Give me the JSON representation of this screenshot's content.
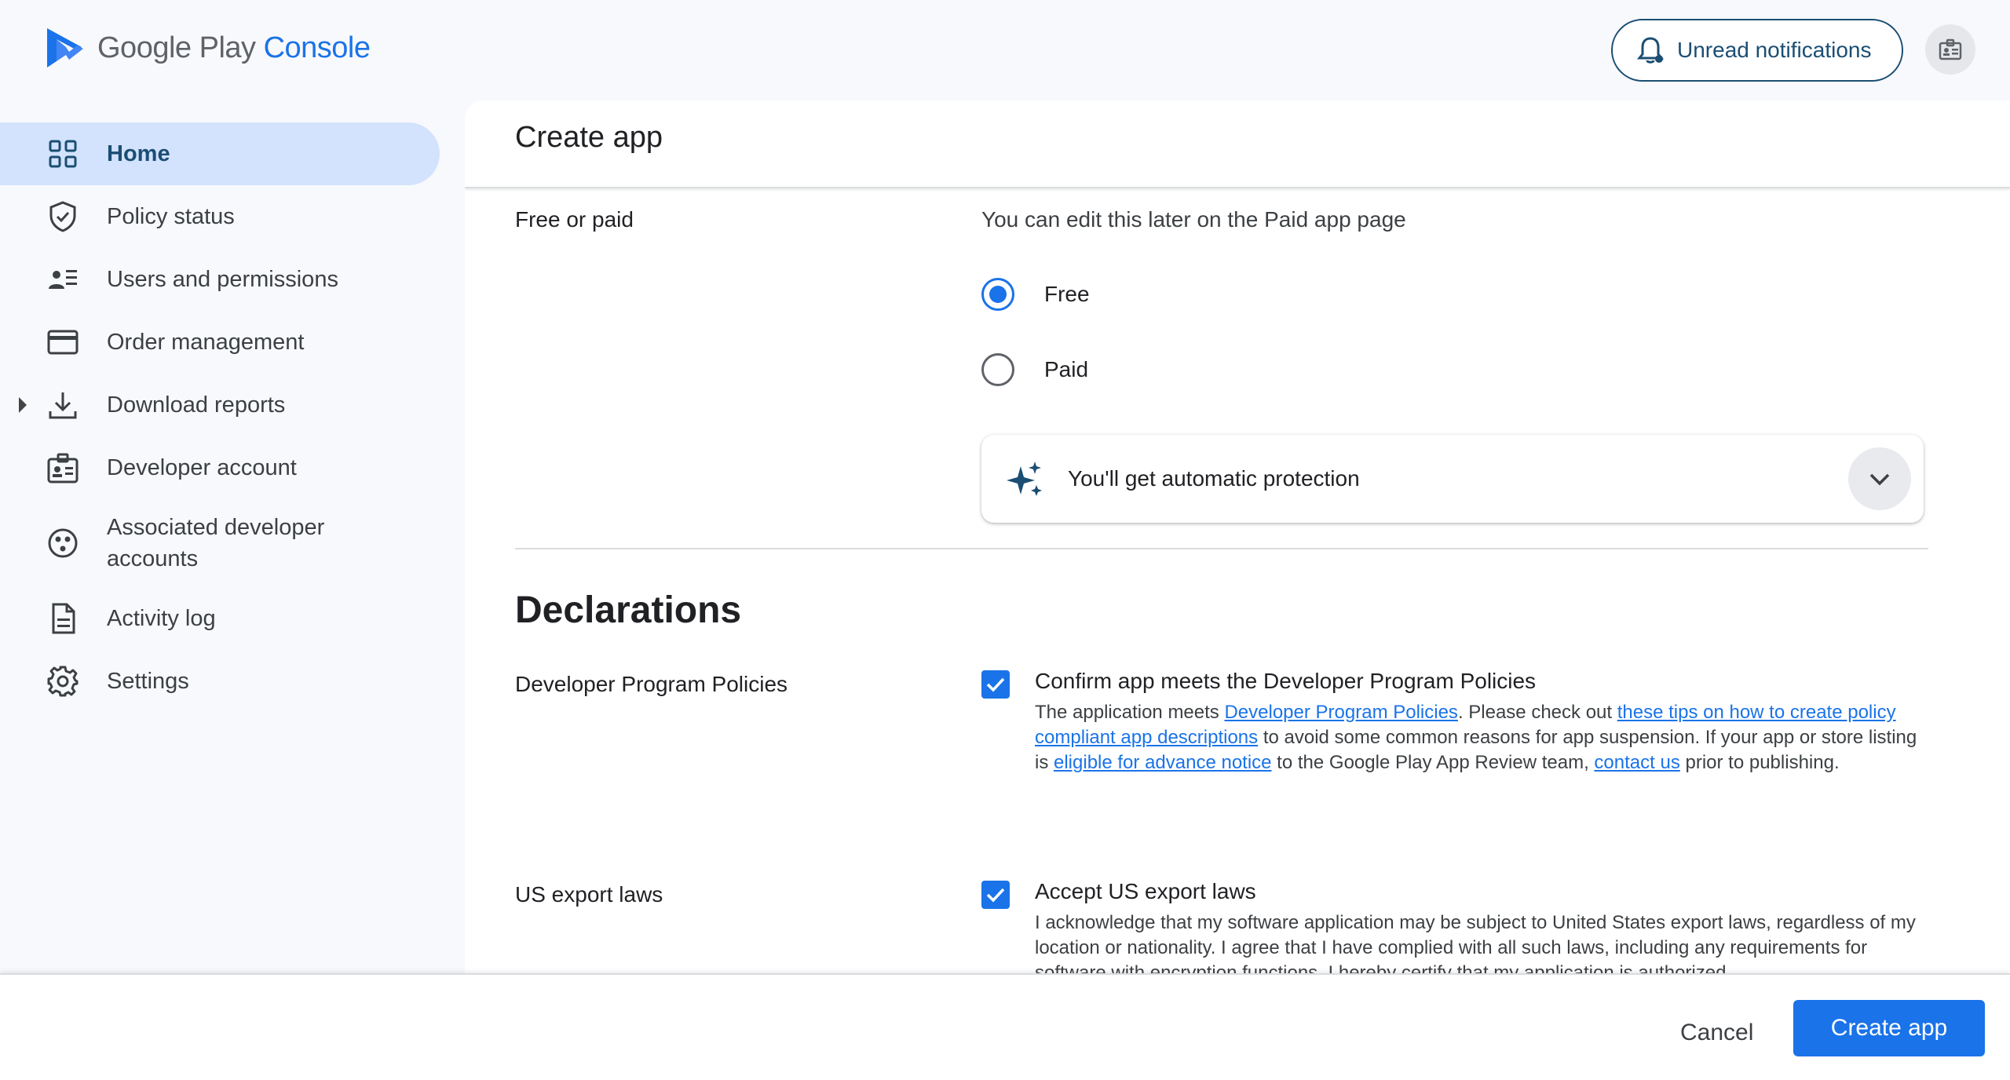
{
  "header": {
    "logo_google_play": "Google Play",
    "logo_console": "Console",
    "notifications_label": "Unread notifications",
    "account_icon": "account-badge-icon"
  },
  "sidebar": {
    "items": [
      {
        "label": "Home",
        "icon": "dashboard-grid-icon",
        "active": true
      },
      {
        "label": "Policy status",
        "icon": "shield-check-icon"
      },
      {
        "label": "Users and permissions",
        "icon": "user-list-icon"
      },
      {
        "label": "Order management",
        "icon": "credit-card-icon"
      },
      {
        "label": "Download reports",
        "icon": "download-icon",
        "expandable": true
      },
      {
        "label": "Developer account",
        "icon": "id-badge-icon"
      },
      {
        "label": "Associated developer accounts",
        "icon": "linked-accounts-icon"
      },
      {
        "label": "Activity log",
        "icon": "document-icon"
      },
      {
        "label": "Settings",
        "icon": "gear-icon"
      }
    ]
  },
  "main": {
    "title": "Create app",
    "pricing": {
      "label": "Free or paid",
      "hint": "You can edit this later on the Paid app page",
      "options": [
        {
          "label": "Free",
          "selected": true
        },
        {
          "label": "Paid",
          "selected": false
        }
      ],
      "protection_label": "You'll get automatic protection"
    },
    "declarations": {
      "title": "Declarations",
      "policies": {
        "label": "Developer Program Policies",
        "checkbox_label": "Confirm app meets the Developer Program Policies",
        "checked": true,
        "body_1": "The application meets ",
        "link_1": "Developer Program Policies",
        "body_2": ". Please check out ",
        "link_2": "these tips on how to create policy compliant app descriptions",
        "body_3": " to avoid some common reasons for app suspension. If your app or store listing is ",
        "link_3": "eligible for advance notice",
        "body_4": " to the Google Play App Review team, ",
        "link_4": "contact us",
        "body_5": " prior to publishing."
      },
      "export": {
        "label": "US export laws",
        "checkbox_label": "Accept US export laws",
        "checked": true,
        "body": "I acknowledge that my software application may be subject to United States export laws, regardless of my location or nationality. I agree that I have complied with all such laws, including any requirements for software with encryption functions. I hereby certify that my application is authorized"
      }
    }
  },
  "footer": {
    "cancel_label": "Cancel",
    "create_label": "Create app"
  },
  "colors": {
    "accent": "#1a73e8",
    "nav_active_bg": "#d3e3fd",
    "nav_active_text": "#1b4e73"
  }
}
